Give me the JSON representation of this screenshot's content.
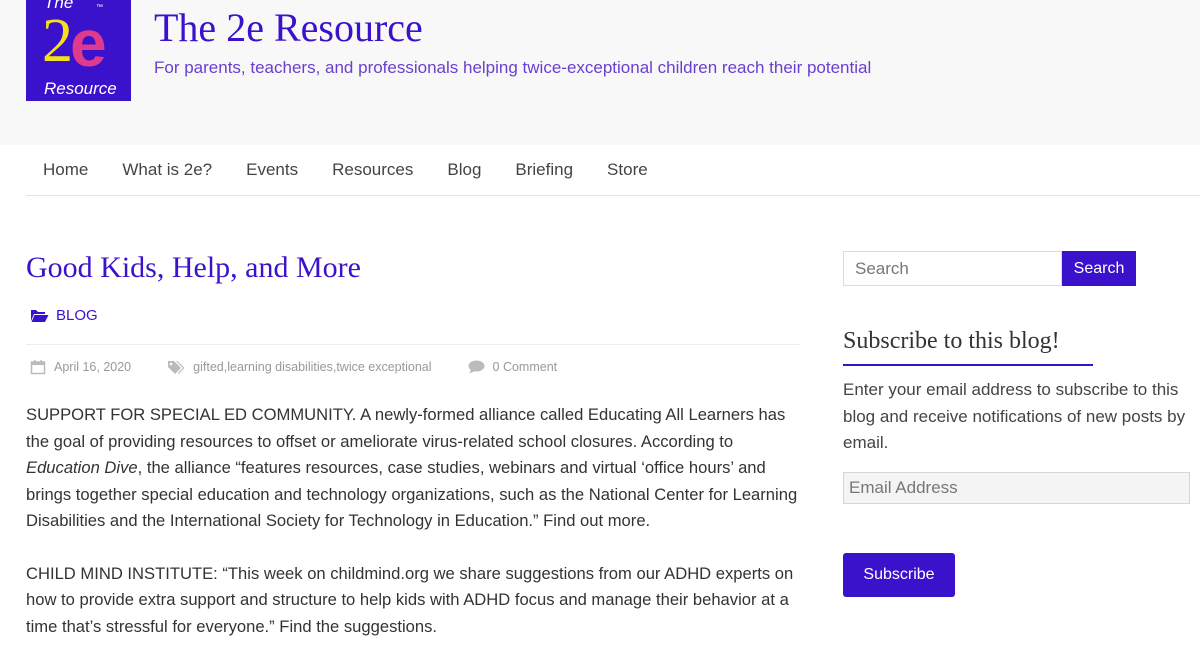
{
  "header": {
    "logo": {
      "top_text": "The",
      "number": "2",
      "letter": "e",
      "trademark": "™",
      "bottom_text": "Resource"
    },
    "site_title": "The 2e Resource",
    "tagline": "For parents, teachers, and professionals helping twice-exceptional children reach their potential"
  },
  "nav": {
    "items": [
      {
        "label": "Home"
      },
      {
        "label": "What is 2e?"
      },
      {
        "label": "Events"
      },
      {
        "label": "Resources"
      },
      {
        "label": "Blog"
      },
      {
        "label": "Briefing"
      },
      {
        "label": "Store"
      }
    ]
  },
  "post": {
    "title": "Good Kids, Help, and More",
    "category": "BLOG",
    "date": "April 16, 2020",
    "tags": [
      "gifted",
      "learning disabilities",
      "twice exceptional"
    ],
    "tag_separator": ", ",
    "comments": "0 Comment",
    "para1_text_a": "SUPPORT FOR SPECIAL ED COMMUNITY. A newly-formed alliance called Educating All Learners has the goal of providing resources to offset or ameliorate virus-related school closures. According to ",
    "para1_source": "Education Dive",
    "para1_text_b": ", the alliance “features resources, case studies, webinars and virtual ‘office hours’ and brings together special education and technology organizations, such as the National Center for Learning Disabilities and the International Society for Technology in Education.” Find out more.",
    "para2_text": "CHILD MIND INSTITUTE: “This week on childmind.org we share suggestions from our ADHD experts on how to provide extra support and structure to help kids with ADHD focus and manage their behavior at a time that’s stressful for everyone.” Find the suggestions."
  },
  "sidebar": {
    "search": {
      "placeholder": "Search",
      "button_label": "Search"
    },
    "subscribe": {
      "title": "Subscribe to this blog!",
      "description": "Enter your email address to subscribe to this blog and receive notifications of new posts by email.",
      "email_placeholder": "Email Address",
      "button_label": "Subscribe"
    }
  },
  "colors": {
    "accent": "#3a12cc",
    "tagline": "#6a3fcf",
    "logo_two": "#f5e11b",
    "logo_e": "#e03a8c"
  },
  "icons": {
    "category": "folder-open-icon",
    "date": "calendar-icon",
    "tags": "tags-icon",
    "comments": "comment-icon"
  }
}
